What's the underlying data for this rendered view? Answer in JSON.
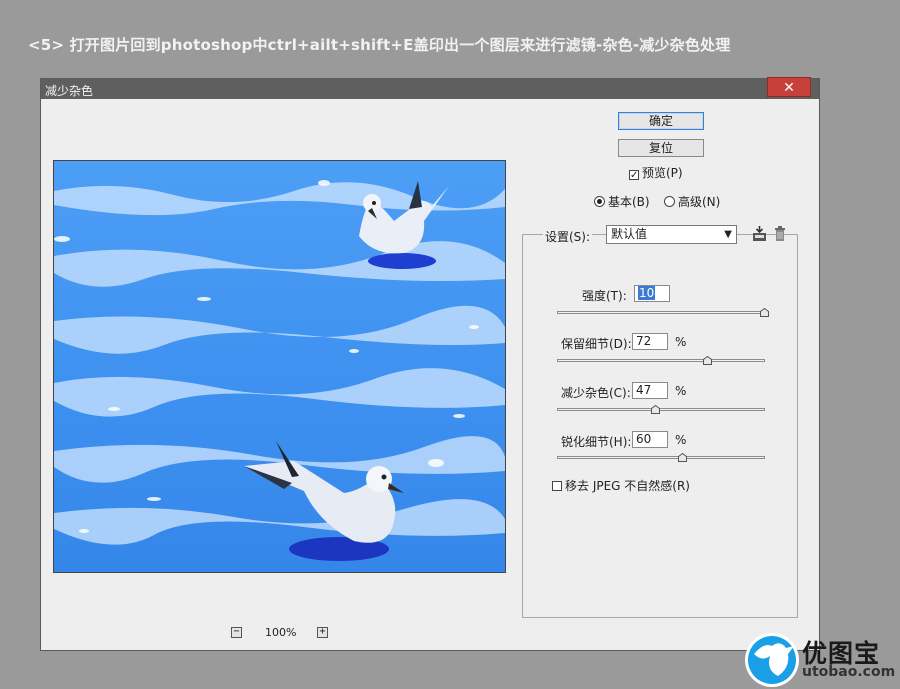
{
  "caption": "<5> 打开图片回到photoshop中ctrl+ailt+shift+E盖印出一个图层来进行滤镜-杂色-减少杂色处理",
  "dialog": {
    "title": "减少杂色",
    "close_label": "✕",
    "ok_label": "确定",
    "reset_label": "复位",
    "preview_label": "预览(P)",
    "preview_checked": true,
    "mode_basic": "基本(B)",
    "mode_advanced": "高级(N)",
    "mode_selected": "basic",
    "settings_label": "设置(S):",
    "settings_value": "默认值",
    "save_icon": "save-preset-icon",
    "delete_icon": "trash-icon",
    "strength_label": "强度(T):",
    "strength_value": "10",
    "strength_max": 10,
    "preserve_label": "保留细节(D):",
    "preserve_value": "72",
    "preserve_unit": "%",
    "reduce_label": "减少杂色(C):",
    "reduce_value": "47",
    "reduce_unit": "%",
    "sharpen_label": "锐化细节(H):",
    "sharpen_value": "60",
    "sharpen_unit": "%",
    "jpeg_label": "移去 JPEG 不自然感(R)",
    "jpeg_checked": false,
    "zoom_out": "−",
    "zoom_level": "100%",
    "zoom_in": "+"
  },
  "watermark": {
    "brand": "优图宝",
    "domain": "utobao.com"
  }
}
